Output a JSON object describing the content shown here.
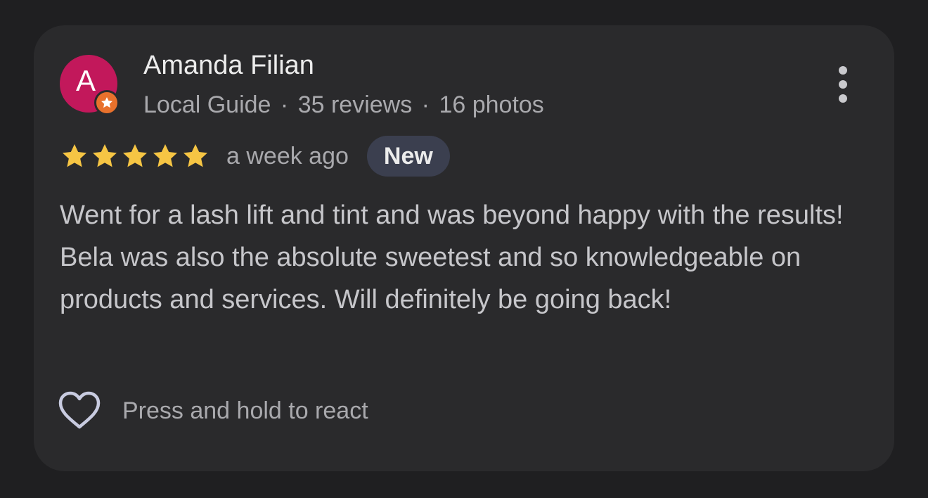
{
  "review": {
    "avatar_letter": "A",
    "reviewer_name": "Amanda Filian",
    "meta": {
      "badge": "Local Guide",
      "separator": "·",
      "reviews": "35 reviews",
      "photos": "16 photos"
    },
    "rating": 5,
    "time": "a week ago",
    "new_badge": "New",
    "text": "Went for a lash lift and tint and was beyond happy with the results! Bela was also the absolute sweetest and so knowledgeable on products and services. Will definitely be going back!",
    "react_prompt": "Press and hold to react"
  },
  "icons": {
    "more": "more-vert-icon",
    "star": "star-icon",
    "heart": "heart-outline-icon",
    "guide": "local-guide-star-icon"
  },
  "colors": {
    "background": "#1f1f21",
    "card": "#2a2a2c",
    "avatar": "#c2185b",
    "local_guide_badge": "#e8712c",
    "star": "#f6c544",
    "new_badge_bg": "#3b3f4f"
  }
}
